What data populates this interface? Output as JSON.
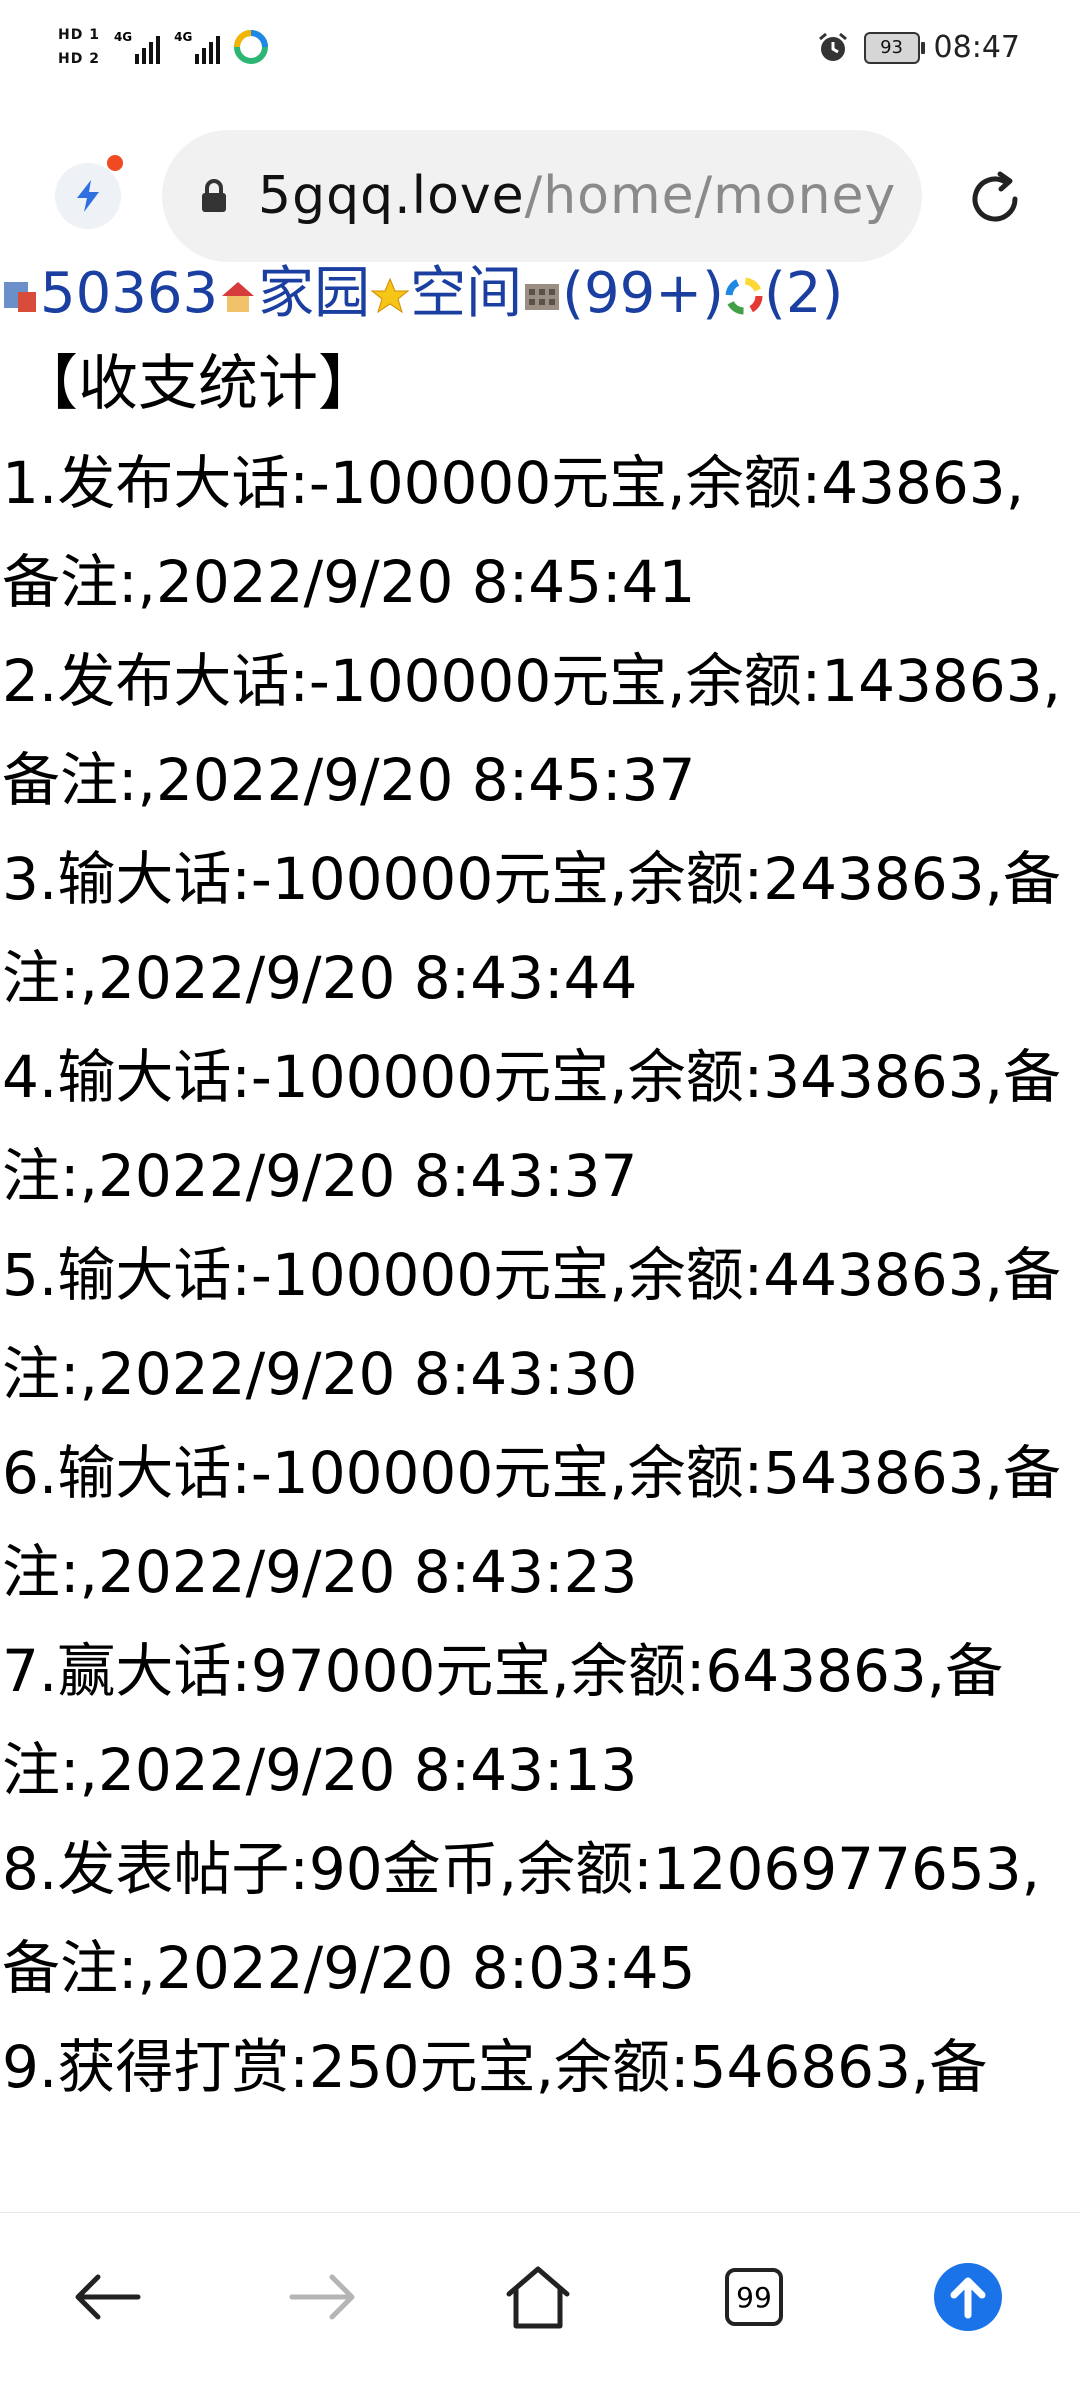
{
  "status_bar": {
    "sim1": "HD 1",
    "sim2": "HD 2",
    "net1": "4G",
    "net2": "4G",
    "battery": "93",
    "time": "08:47"
  },
  "browser": {
    "url_host": "5gqq.love",
    "url_path": "/home/money",
    "tab_count": "99"
  },
  "nav": {
    "user_id": "50363",
    "home": "家园",
    "space": "空间",
    "messages": "(99+)",
    "notifications": "(2)"
  },
  "page": {
    "title": "【收支统计】"
  },
  "records": [
    "1.发布大话:-100000元宝,余额:43863,备注:,2022/9/20 8:45:41",
    "2.发布大话:-100000元宝,余额:143863,备注:,2022/9/20 8:45:37",
    "3.输大话:-100000元宝,余额:243863,备注:,2022/9/20 8:43:44",
    "4.输大话:-100000元宝,余额:343863,备注:,2022/9/20 8:43:37",
    "5.输大话:-100000元宝,余额:443863,备注:,2022/9/20 8:43:30",
    "6.输大话:-100000元宝,余额:543863,备注:,2022/9/20 8:43:23",
    "7.赢大话:97000元宝,余额:643863,备注:,2022/9/20 8:43:13",
    "8.发表帖子:90金币,余额:1206977653,备注:,2022/9/20 8:03:45",
    "9.获得打赏:250元宝,余额:546863,备"
  ],
  "colors": {
    "link": "#1a3fa0",
    "accent_blue": "#1a73e8",
    "notification_dot": "#f04a23"
  }
}
